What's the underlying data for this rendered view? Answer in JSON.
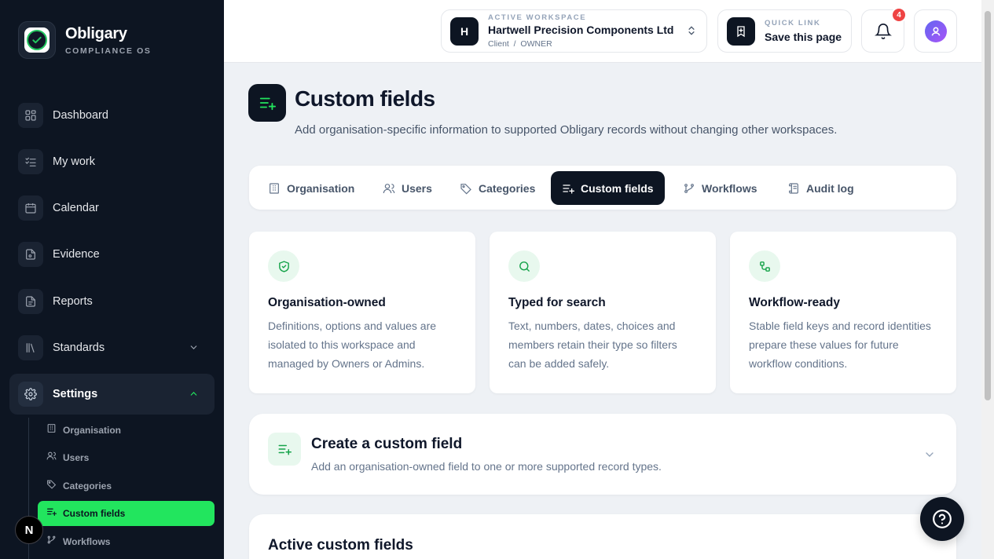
{
  "brand": {
    "name": "Obligary",
    "subtitle": "COMPLIANCE OS"
  },
  "sidebar": {
    "items": [
      {
        "label": "Dashboard",
        "icon": "grid-icon"
      },
      {
        "label": "My work",
        "icon": "checklist-icon"
      },
      {
        "label": "Calendar",
        "icon": "calendar-icon"
      },
      {
        "label": "Evidence",
        "icon": "evidence-file-icon"
      },
      {
        "label": "Reports",
        "icon": "report-file-icon"
      },
      {
        "label": "Standards",
        "icon": "library-icon"
      },
      {
        "label": "Settings",
        "icon": "gear-icon"
      }
    ],
    "settings_sub": [
      {
        "label": "Organisation",
        "icon": "building-icon"
      },
      {
        "label": "Users",
        "icon": "users-icon"
      },
      {
        "label": "Categories",
        "icon": "tags-icon"
      },
      {
        "label": "Custom fields",
        "icon": "list-plus-icon"
      },
      {
        "label": "Workflows",
        "icon": "workflow-icon"
      }
    ],
    "badge": "N"
  },
  "header": {
    "workspace": {
      "initial": "H",
      "kicker": "ACTIVE WORKSPACE",
      "name": "Hartwell Precision Components Ltd",
      "role": "Client  /  OWNER"
    },
    "quick_link": {
      "kicker": "QUICK LINK",
      "label": "Save this page"
    },
    "notifications_count": "4"
  },
  "page": {
    "title": "Custom fields",
    "subtitle": "Add organisation-specific information to supported Obligary records without changing other workspaces."
  },
  "tabs": [
    {
      "label": "Organisation"
    },
    {
      "label": "Users"
    },
    {
      "label": "Categories"
    },
    {
      "label": "Custom fields"
    },
    {
      "label": "Workflows"
    },
    {
      "label": "Audit log"
    }
  ],
  "cards": [
    {
      "title": "Organisation-owned",
      "text": "Definitions, options and values are isolated to this workspace and managed by Owners or Admins.",
      "icon": "shield-check-icon"
    },
    {
      "title": "Typed for search",
      "text": "Text, numbers, dates, choices and members retain their type so filters can be added safely.",
      "icon": "search-icon"
    },
    {
      "title": "Workflow-ready",
      "text": "Stable field keys and record identities prepare these values for future workflow conditions.",
      "icon": "workflow-icon"
    }
  ],
  "create": {
    "title": "Create a custom field",
    "subtitle": "Add an organisation-owned field to one or more supported record types."
  },
  "active": {
    "title": "Active custom fields"
  },
  "colors": {
    "sidebar_bg": "#0d1522",
    "accent_green": "#22e55e",
    "badge_red": "#ef4444"
  }
}
